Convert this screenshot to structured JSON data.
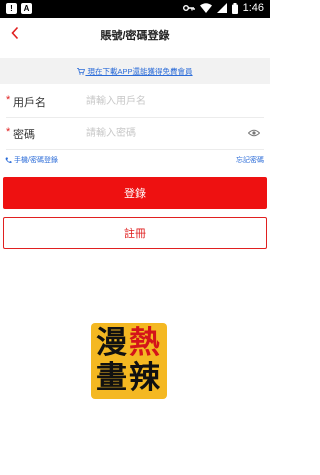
{
  "status_bar": {
    "time": "1:46"
  },
  "header": {
    "title": "賬號/密碼登錄",
    "back_icon": "chevron-left-icon"
  },
  "promo": {
    "text": "現在下載APP還能獲得免費會員"
  },
  "form": {
    "username": {
      "required_mark": "*",
      "label": "用戶名",
      "placeholder": "請輸入用戶名"
    },
    "password": {
      "required_mark": "*",
      "label": "密碼",
      "placeholder": "請輸入密碼"
    }
  },
  "links": {
    "phone_login": "手機/密碼登錄",
    "forgot_password": "忘記密碼"
  },
  "buttons": {
    "login": "登錄",
    "register": "註冊"
  },
  "logo": {
    "chars": [
      "漫",
      "熱",
      "畫",
      "辣"
    ]
  },
  "colors": {
    "accent": "#ee1111",
    "link": "#2a6bd8",
    "logo_bg": "#f4b822"
  }
}
